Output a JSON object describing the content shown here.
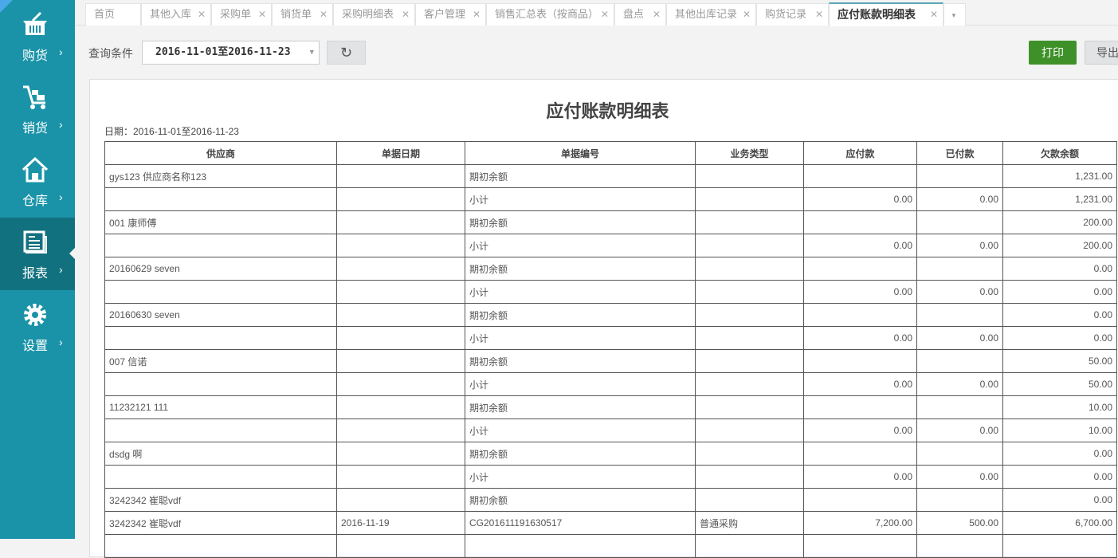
{
  "sidebar": [
    {
      "label": "购货",
      "icon": "basket-icon"
    },
    {
      "label": "销货",
      "icon": "cart-icon"
    },
    {
      "label": "仓库",
      "icon": "home-icon"
    },
    {
      "label": "报表",
      "icon": "report-icon",
      "active": true
    },
    {
      "label": "设置",
      "icon": "gear-icon"
    }
  ],
  "tabs": [
    "首页",
    "其他入库",
    "采购单",
    "销货单",
    "采购明细表",
    "客户管理",
    "销售汇总表（按商品）",
    "盘点",
    "其他出库记录",
    "购货记录",
    "应付账款明细表"
  ],
  "toolbar": {
    "query_label": "查询条件",
    "date_range": "2016-11-01至2016-11-23",
    "print": "打印",
    "export": "导出"
  },
  "report": {
    "title": "应付账款明细表",
    "date_line": "日期：2016-11-01至2016-11-23",
    "columns": [
      "供应商",
      "单据日期",
      "单据编号",
      "业务类型",
      "应付款",
      "已付款",
      "欠款余额"
    ],
    "rows": [
      [
        "gys123 供应商名称123",
        "",
        "期初余额",
        "",
        "",
        "",
        "1,231.00"
      ],
      [
        "",
        "",
        "小计",
        "",
        "0.00",
        "0.00",
        "1,231.00"
      ],
      [
        "001 康师傅",
        "",
        "期初余额",
        "",
        "",
        "",
        "200.00"
      ],
      [
        "",
        "",
        "小计",
        "",
        "0.00",
        "0.00",
        "200.00"
      ],
      [
        "20160629 seven",
        "",
        "期初余额",
        "",
        "",
        "",
        "0.00"
      ],
      [
        "",
        "",
        "小计",
        "",
        "0.00",
        "0.00",
        "0.00"
      ],
      [
        "20160630 seven",
        "",
        "期初余额",
        "",
        "",
        "",
        "0.00"
      ],
      [
        "",
        "",
        "小计",
        "",
        "0.00",
        "0.00",
        "0.00"
      ],
      [
        "007 信诺",
        "",
        "期初余额",
        "",
        "",
        "",
        "50.00"
      ],
      [
        "",
        "",
        "小计",
        "",
        "0.00",
        "0.00",
        "50.00"
      ],
      [
        "11232121 111",
        "",
        "期初余额",
        "",
        "",
        "",
        "10.00"
      ],
      [
        "",
        "",
        "小计",
        "",
        "0.00",
        "0.00",
        "10.00"
      ],
      [
        "dsdg 啊",
        "",
        "期初余额",
        "",
        "",
        "",
        "0.00"
      ],
      [
        "",
        "",
        "小计",
        "",
        "0.00",
        "0.00",
        "0.00"
      ],
      [
        "3242342 崔聪vdf",
        "",
        "期初余额",
        "",
        "",
        "",
        "0.00"
      ],
      [
        "3242342 崔聪vdf",
        "2016-11-19",
        "CG201611191630517",
        "普通采购",
        "7,200.00",
        "500.00",
        "6,700.00"
      ],
      [
        "",
        "",
        "",
        "",
        "",
        "",
        ""
      ]
    ]
  }
}
